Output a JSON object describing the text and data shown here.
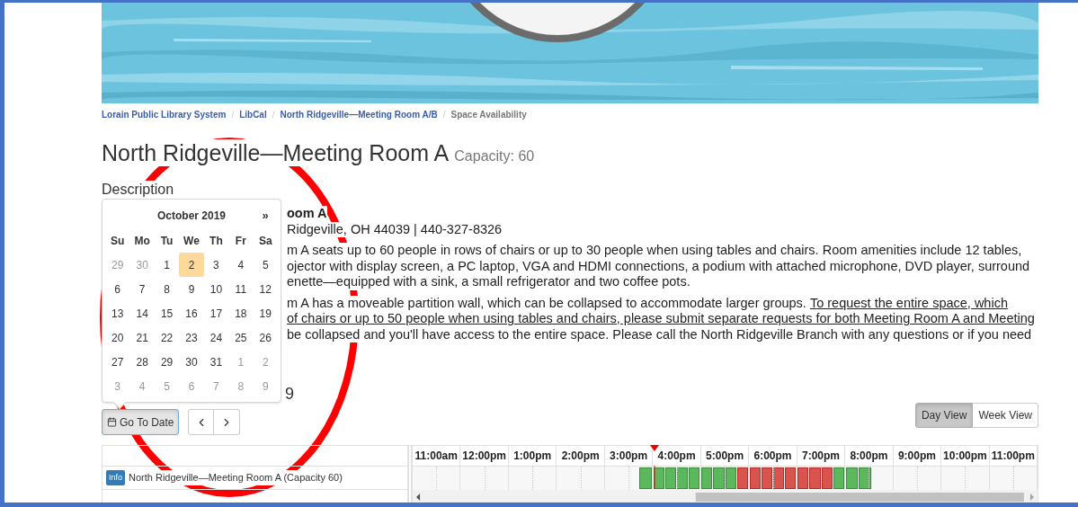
{
  "breadcrumbs": {
    "separator": "/",
    "items": [
      {
        "label": "Lorain Public Library System",
        "current": false
      },
      {
        "label": "LibCal",
        "current": false
      },
      {
        "label": "North Ridgeville—Meeting Room A/B",
        "current": false
      },
      {
        "label": "Space Availability",
        "current": true
      }
    ]
  },
  "title": "North Ridgeville—Meeting Room A",
  "capacity": "Capacity: 60",
  "description": {
    "heading": "Description",
    "paragraphs": [
      {
        "lines": [
          [
            {
              "text": "oom A",
              "kind": "bold"
            }
          ],
          [
            {
              "text": "Ridgeville, OH 44039 | 440-327-8326",
              "kind": "plain"
            }
          ]
        ]
      },
      {
        "lines": [
          [
            {
              "text": "m A seats up to 60 people in rows of chairs or up to 30 people when using tables and chairs. Room amenities include 12 tables,",
              "kind": "plain"
            }
          ],
          [
            {
              "text": "ojector with display screen, a PC laptop, VGA and HDMI connections, a podium with attached microphone, DVD player, surround",
              "kind": "plain"
            }
          ],
          [
            {
              "text": "enette—equipped with a sink, a small refrigerator and two coffee pots.",
              "kind": "plain"
            }
          ]
        ]
      },
      {
        "lines": [
          [
            {
              "text": "m A has a moveable partition wall, which can be collapsed to accommodate larger groups.",
              "kind": "plain"
            },
            {
              "text": "To request the entire space, which",
              "kind": "link"
            }
          ],
          [
            {
              "text": "of chairs or up to 50 people when using tables and chairs, please submit separate requests for both Meeting Room A and Meeting",
              "kind": "link"
            }
          ],
          [
            {
              "text": "be collapsed and you'll have access to the entire space. Please call the North Ridgeville Branch with any questions or if you need",
              "kind": "plain"
            }
          ]
        ]
      }
    ]
  },
  "date_heading": "9",
  "calendar": {
    "title": "October 2019",
    "next": "»",
    "weekdays": [
      "Su",
      "Mo",
      "Tu",
      "We",
      "Th",
      "Fr",
      "Sa"
    ],
    "weeks": [
      [
        {
          "day": "29",
          "outside": true,
          "selected": false
        },
        {
          "day": "30",
          "outside": true,
          "selected": false
        },
        {
          "day": "1",
          "outside": false,
          "selected": false
        },
        {
          "day": "2",
          "outside": false,
          "selected": true
        },
        {
          "day": "3",
          "outside": false,
          "selected": false
        },
        {
          "day": "4",
          "outside": false,
          "selected": false
        },
        {
          "day": "5",
          "outside": false,
          "selected": false
        }
      ],
      [
        {
          "day": "6",
          "outside": false,
          "selected": false
        },
        {
          "day": "7",
          "outside": false,
          "selected": false
        },
        {
          "day": "8",
          "outside": false,
          "selected": false
        },
        {
          "day": "9",
          "outside": false,
          "selected": false
        },
        {
          "day": "10",
          "outside": false,
          "selected": false
        },
        {
          "day": "11",
          "outside": false,
          "selected": false
        },
        {
          "day": "12",
          "outside": false,
          "selected": false
        }
      ],
      [
        {
          "day": "13",
          "outside": false,
          "selected": false
        },
        {
          "day": "14",
          "outside": false,
          "selected": false
        },
        {
          "day": "15",
          "outside": false,
          "selected": false
        },
        {
          "day": "16",
          "outside": false,
          "selected": false
        },
        {
          "day": "17",
          "outside": false,
          "selected": false
        },
        {
          "day": "18",
          "outside": false,
          "selected": false
        },
        {
          "day": "19",
          "outside": false,
          "selected": false
        }
      ],
      [
        {
          "day": "20",
          "outside": false,
          "selected": false
        },
        {
          "day": "21",
          "outside": false,
          "selected": false
        },
        {
          "day": "22",
          "outside": false,
          "selected": false
        },
        {
          "day": "23",
          "outside": false,
          "selected": false
        },
        {
          "day": "24",
          "outside": false,
          "selected": false
        },
        {
          "day": "25",
          "outside": false,
          "selected": false
        },
        {
          "day": "26",
          "outside": false,
          "selected": false
        }
      ],
      [
        {
          "day": "27",
          "outside": false,
          "selected": false
        },
        {
          "day": "28",
          "outside": false,
          "selected": false
        },
        {
          "day": "29",
          "outside": false,
          "selected": false
        },
        {
          "day": "30",
          "outside": false,
          "selected": false
        },
        {
          "day": "31",
          "outside": false,
          "selected": false
        },
        {
          "day": "1",
          "outside": true,
          "selected": false
        },
        {
          "day": "2",
          "outside": true,
          "selected": false
        }
      ],
      [
        {
          "day": "3",
          "outside": true,
          "selected": false
        },
        {
          "day": "4",
          "outside": true,
          "selected": false
        },
        {
          "day": "5",
          "outside": true,
          "selected": false
        },
        {
          "day": "6",
          "outside": true,
          "selected": false
        },
        {
          "day": "7",
          "outside": true,
          "selected": false
        },
        {
          "day": "8",
          "outside": true,
          "selected": false
        },
        {
          "day": "9",
          "outside": true,
          "selected": false
        }
      ]
    ]
  },
  "go_to_date": {
    "label": "Go To Date",
    "active": true
  },
  "views": [
    {
      "label": "Day View",
      "selected": true
    },
    {
      "label": "Week View",
      "selected": false
    }
  ],
  "schedule": {
    "rooms": [
      {
        "badge": "Info",
        "name": "North Ridgeville—Meeting Room A (Capacity 60)"
      }
    ],
    "hours": [
      {
        "label": "11:00am",
        "now": false,
        "slots": [
          {
            "kind": "empty"
          },
          {
            "kind": "empty"
          },
          {
            "kind": "empty"
          },
          {
            "kind": "empty"
          }
        ]
      },
      {
        "label": "12:00pm",
        "now": false,
        "slots": [
          {
            "kind": "empty"
          },
          {
            "kind": "empty"
          },
          {
            "kind": "empty"
          },
          {
            "kind": "empty"
          }
        ]
      },
      {
        "label": "1:00pm",
        "now": false,
        "slots": [
          {
            "kind": "empty"
          },
          {
            "kind": "empty"
          },
          {
            "kind": "empty"
          },
          {
            "kind": "empty"
          }
        ]
      },
      {
        "label": "2:00pm",
        "now": false,
        "slots": [
          {
            "kind": "empty"
          },
          {
            "kind": "empty"
          },
          {
            "kind": "empty"
          },
          {
            "kind": "empty"
          }
        ]
      },
      {
        "label": "3:00pm",
        "now": false,
        "slots": [
          {
            "kind": "empty"
          },
          {
            "kind": "empty"
          },
          {
            "kind": "empty"
          },
          {
            "kind": "available"
          }
        ]
      },
      {
        "label": "4:00pm",
        "now": true,
        "slots": [
          {
            "kind": "available"
          },
          {
            "kind": "available"
          },
          {
            "kind": "available"
          },
          {
            "kind": "available"
          }
        ]
      },
      {
        "label": "5:00pm",
        "now": false,
        "slots": [
          {
            "kind": "available"
          },
          {
            "kind": "available"
          },
          {
            "kind": "available"
          },
          {
            "kind": "booked"
          }
        ]
      },
      {
        "label": "6:00pm",
        "now": false,
        "slots": [
          {
            "kind": "booked"
          },
          {
            "kind": "booked"
          },
          {
            "kind": "booked"
          },
          {
            "kind": "booked"
          }
        ]
      },
      {
        "label": "7:00pm",
        "now": false,
        "slots": [
          {
            "kind": "booked"
          },
          {
            "kind": "booked"
          },
          {
            "kind": "booked"
          },
          {
            "kind": "available"
          }
        ]
      },
      {
        "label": "8:00pm",
        "now": false,
        "slots": [
          {
            "kind": "available"
          },
          {
            "kind": "available"
          },
          {
            "kind": "empty"
          },
          {
            "kind": "empty"
          }
        ]
      },
      {
        "label": "9:00pm",
        "now": false,
        "slots": [
          {
            "kind": "empty"
          },
          {
            "kind": "empty"
          },
          {
            "kind": "empty"
          },
          {
            "kind": "empty"
          }
        ]
      },
      {
        "label": "10:00pm",
        "now": false,
        "slots": [
          {
            "kind": "empty"
          },
          {
            "kind": "empty"
          },
          {
            "kind": "empty"
          },
          {
            "kind": "empty"
          }
        ]
      },
      {
        "label": "11:00pm",
        "now": false,
        "slots": [
          {
            "kind": "empty"
          },
          {
            "kind": "empty"
          },
          {
            "kind": "empty"
          },
          {
            "kind": "empty"
          }
        ]
      }
    ]
  },
  "annotation": {
    "kind": "circle"
  }
}
